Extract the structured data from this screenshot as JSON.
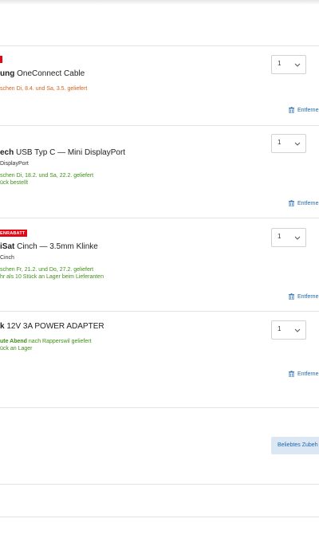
{
  "items": [
    {
      "brand": "ung",
      "name": " OneConnect Cable",
      "variant": "",
      "delivery": "schen Di, 8.4. und Sa, 3.5. geliefert",
      "stock": "",
      "qty": "1",
      "remove_label": "Entferne"
    },
    {
      "brand": "ech",
      "name": " USB Typ C — Mini DisplayPort",
      "variant": " DisplayPort",
      "delivery": "schen Di, 18.2. und Sa, 22.2. geliefert",
      "stock": "ück bestellt",
      "qty": "1",
      "remove_label": "Entferne"
    },
    {
      "badge": "ENRABATT",
      "brand": "iSat",
      "name": " Cinch — 3.5mm Klinke",
      "variant": " Cinch",
      "delivery": "schen Fr, 21.2. und Do, 27.2. geliefert",
      "stock": "hr als 10 Stück an Lager beim Lieferanten",
      "qty": "1",
      "remove_label": "Entferne"
    },
    {
      "brand": "k",
      "name": " 12V 3A POWER ADAPTER",
      "delivery_bold": "ute Abend",
      "delivery": " nach Rapperswil geliefert",
      "stock": "ück an Lager",
      "qty": "1",
      "remove_label": "Entferne"
    }
  ],
  "accessory_button": "Beliebtes Zubeh",
  "colors": {
    "green": "#3f8f1a",
    "orange": "#d4621d",
    "link": "#1f67b0",
    "badge_red": "#e30613"
  },
  "icons": [
    "chevron-down-icon",
    "trash-icon"
  ]
}
